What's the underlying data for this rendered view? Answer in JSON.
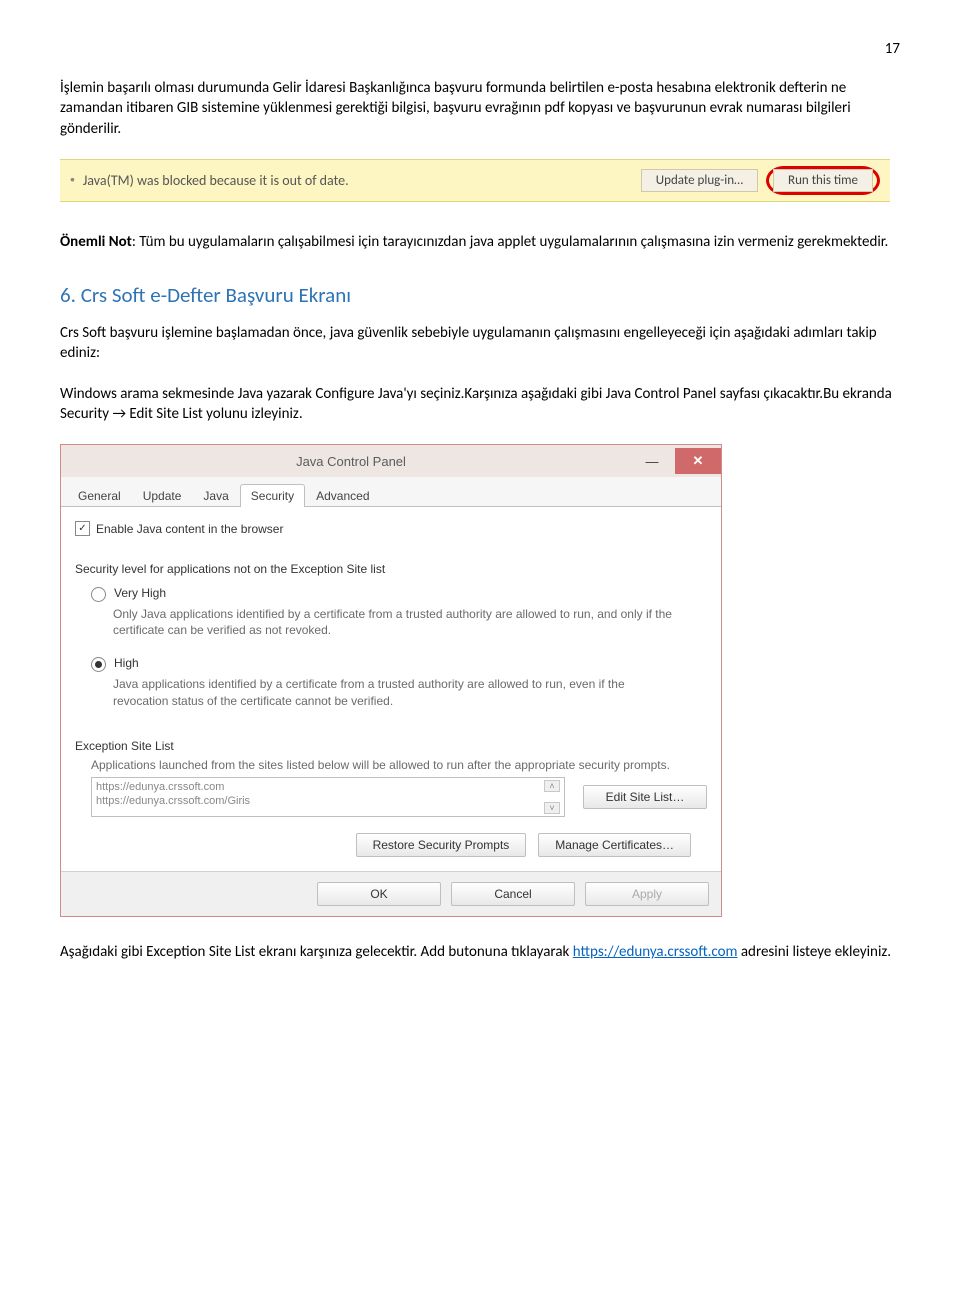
{
  "page_number": "17",
  "para1": "İşlemin başarılı olması durumunda Gelir İdaresi Başkanlığınca başvuru formunda belirtilen e-posta hesabına elektronik defterin ne zamandan itibaren GIB sistemine yüklenmesi gerektiği bilgisi, başvuru evrağının pdf kopyası ve başvurunun evrak numarası bilgileri gönderilir.",
  "java_bar": {
    "message": "Java(TM) was blocked because it is out of date.",
    "update_btn": "Update plug-in…",
    "run_btn": "Run this time"
  },
  "para2_prefix": "Önemli Not",
  "para2_rest": ": Tüm bu uygulamaların çalışabilmesi için tarayıcınızdan java applet uygulamalarının çalışmasına izin vermeniz gerekmektedir.",
  "heading": "6. Crs Soft e-Defter Başvuru Ekranı",
  "para3": "Crs Soft başvuru işlemine başlamadan önce, java güvenlik sebebiyle uygulamanın çalışmasını engelleyeceği için aşağıdaki adımları takip ediniz:",
  "para4": "Windows arama sekmesinde Java yazarak Configure Java'yı seçiniz.Karşınıza aşağıdaki gibi Java Control Panel sayfası çıkacaktır.Bu ekranda  Security → Edit Site List yolunu izleyiniz.",
  "jcp": {
    "title": "Java Control Panel",
    "tabs": [
      "General",
      "Update",
      "Java",
      "Security",
      "Advanced"
    ],
    "active_tab_index": 3,
    "enable_checkbox": "Enable Java content in the browser",
    "sec_level_label": "Security level for applications not on the Exception Site list",
    "very_high_label": "Very High",
    "very_high_desc": "Only Java applications identified by a certificate from a trusted authority are allowed to run, and only if the certificate can be verified as not revoked.",
    "high_label": "High",
    "high_desc": "Java applications identified by a certificate from a trusted authority are allowed to run, even if the revocation status of the certificate cannot be verified.",
    "exc_label": "Exception Site List",
    "exc_desc": "Applications launched from the sites listed below will be allowed to run after the appropriate security prompts.",
    "sites": [
      "https://edunya.crssoft.com",
      "https://edunya.crssoft.com/Giris"
    ],
    "edit_btn": "Edit Site List…",
    "restore_btn": "Restore Security Prompts",
    "manage_btn": "Manage Certificates…",
    "ok_btn": "OK",
    "cancel_btn": "Cancel",
    "apply_btn": "Apply"
  },
  "para5_a": "Aşağıdaki gibi Exception Site List ekranı karşınıza gelecektir. Add butonuna tıklayarak ",
  "para5_link": "https://edunya.crssoft.com",
  "para5_b": " adresini listeye ekleyiniz."
}
